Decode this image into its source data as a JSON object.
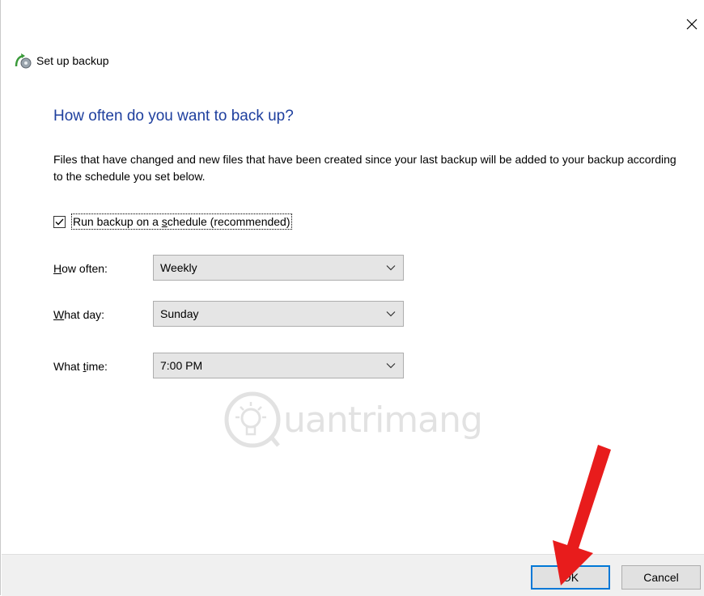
{
  "window": {
    "title": "Set up backup",
    "close_glyph": "✕"
  },
  "heading": "How often do you want to back up?",
  "description": "Files that have changed and new files that have been created since your last backup will be added to your backup according to the schedule you set below.",
  "schedule_checkbox": {
    "label_before": "Run backup on a ",
    "label_access": "s",
    "label_after": "chedule (recommended)",
    "checked": true
  },
  "fields": {
    "how_often": {
      "label_access": "H",
      "label_rest": "ow often:",
      "value": "Weekly"
    },
    "what_day": {
      "label_access": "W",
      "label_rest": "hat day:",
      "value": "Sunday"
    },
    "what_time": {
      "label_before": "What ",
      "label_access": "t",
      "label_rest": "ime:",
      "value": "7:00 PM"
    }
  },
  "buttons": {
    "ok": "OK",
    "cancel": "Cancel"
  },
  "watermark": {
    "text": "uantrimang"
  },
  "colors": {
    "heading": "#1e3f9e",
    "ok_border": "#0078d7",
    "annotation_arrow": "#e81c1c"
  },
  "icons": {
    "title": "backup-icon",
    "close": "close-icon",
    "checkbox": "checkmark-icon",
    "dropdown": "chevron-down-icon",
    "annotation": "red-arrow-icon"
  }
}
